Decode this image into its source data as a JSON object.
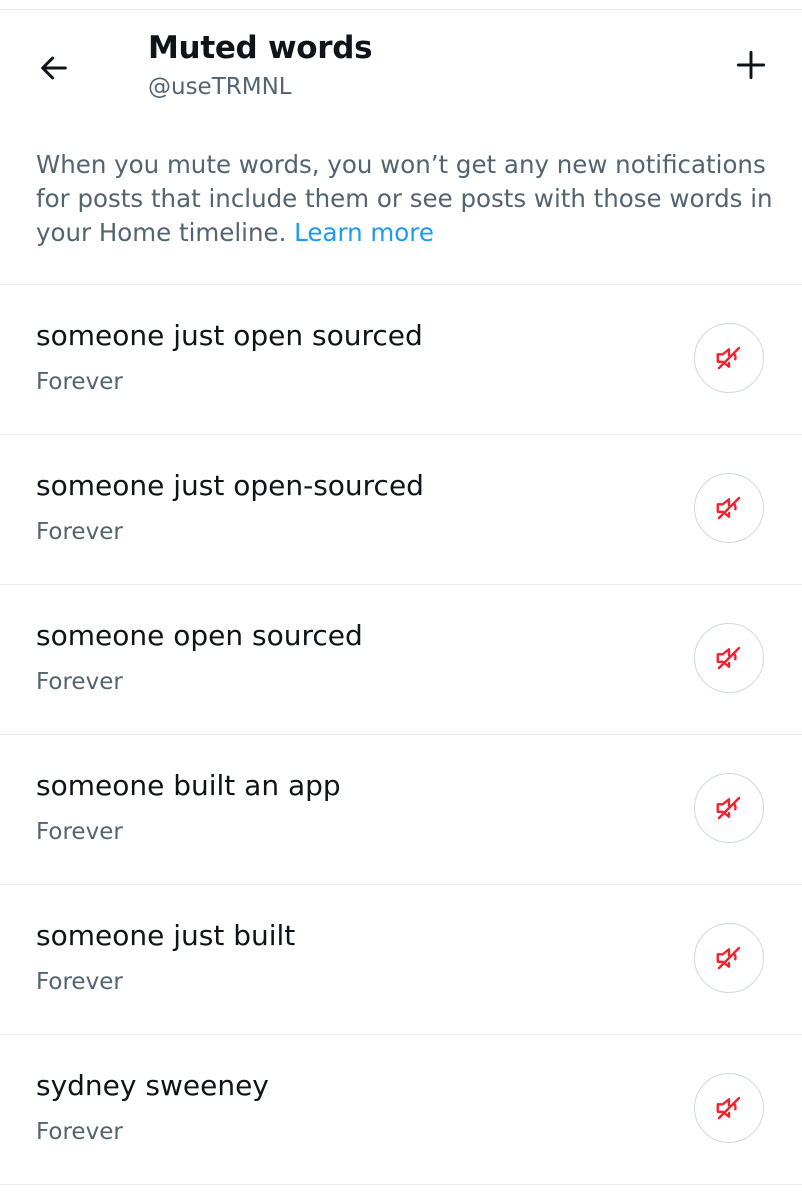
{
  "header": {
    "title": "Muted words",
    "handle": "@useTRMNL",
    "back_icon": "arrow-left-icon",
    "add_icon": "plus-icon"
  },
  "description": {
    "text": "When you mute words, you won’t get any new notifications for posts that include them or see posts with those words in your Home timeline.",
    "link_text": "Learn more"
  },
  "muted_words": [
    {
      "word": "someone just open sourced",
      "duration": "Forever",
      "icon": "speaker-muted-icon"
    },
    {
      "word": "someone just open-sourced",
      "duration": "Forever",
      "icon": "speaker-muted-icon"
    },
    {
      "word": "someone open sourced",
      "duration": "Forever",
      "icon": "speaker-muted-icon"
    },
    {
      "word": "someone built an app",
      "duration": "Forever",
      "icon": "speaker-muted-icon"
    },
    {
      "word": "someone just built",
      "duration": "Forever",
      "icon": "speaker-muted-icon"
    },
    {
      "word": "sydney sweeney",
      "duration": "Forever",
      "icon": "speaker-muted-icon"
    }
  ],
  "colors": {
    "text_primary": "#0f1419",
    "text_secondary": "#536471",
    "link": "#1d9bf0",
    "mute_icon": "#f4212e",
    "divider": "#e7e9ea",
    "button_border": "#cfd9de"
  }
}
